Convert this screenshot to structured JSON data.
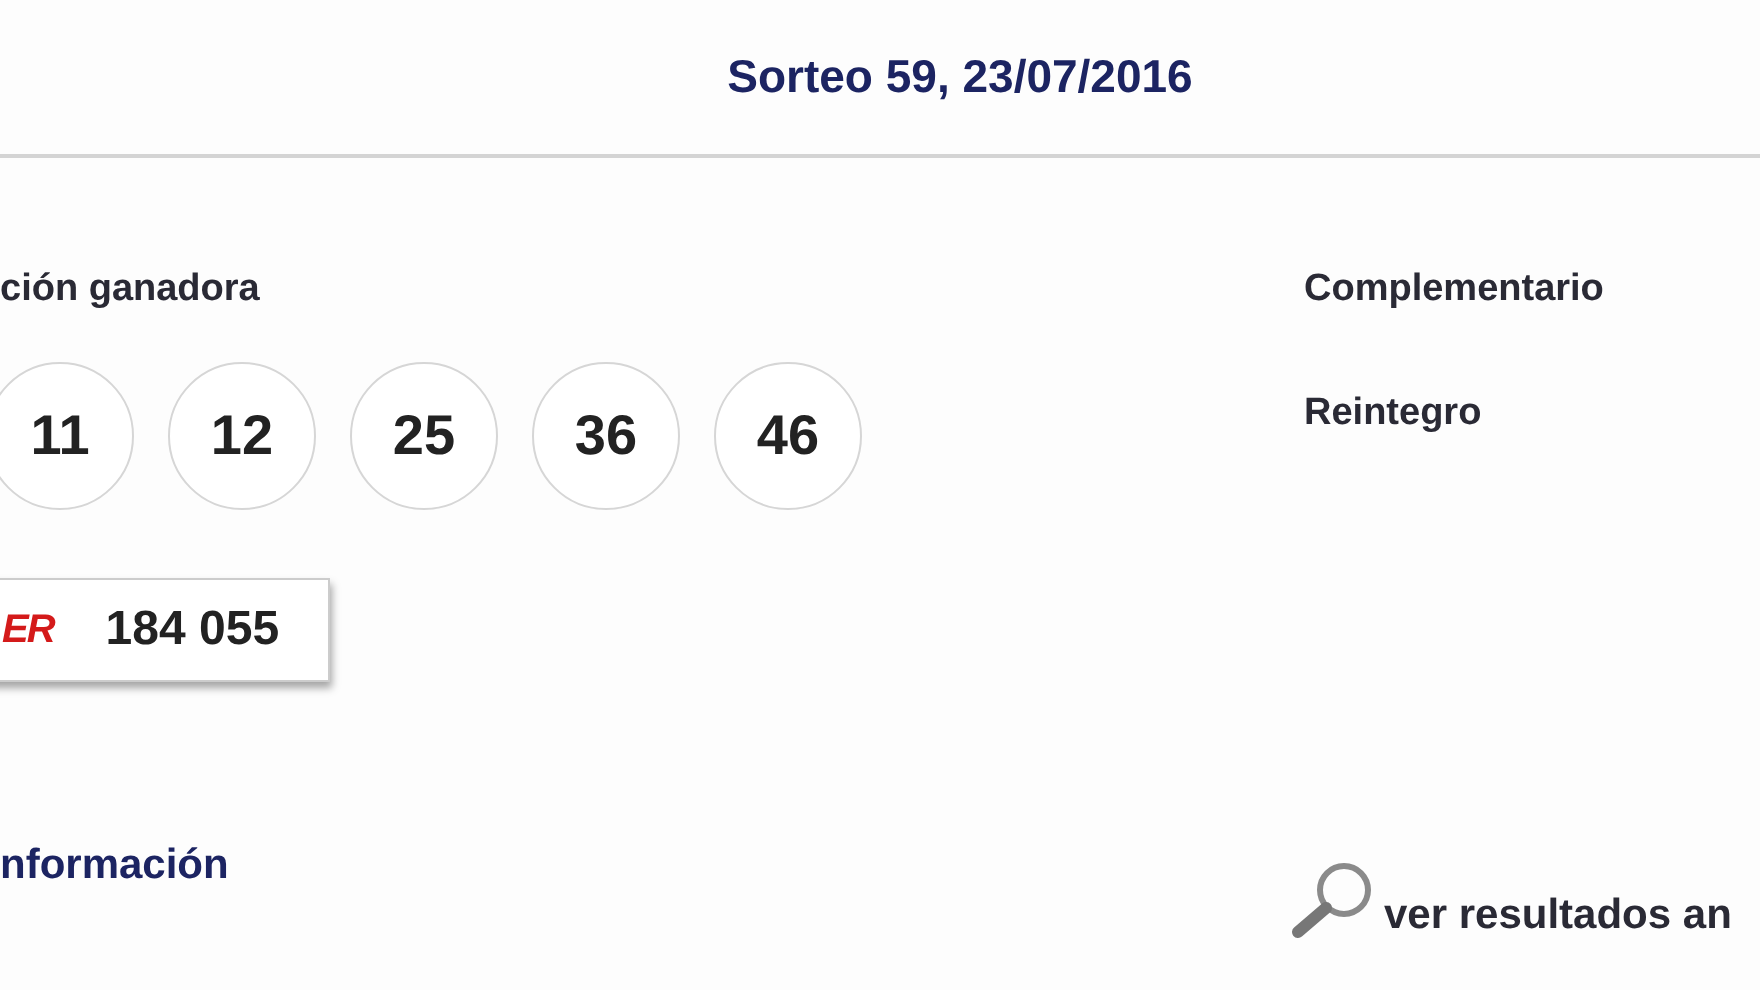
{
  "header": {
    "title": "Sorteo 59, 23/07/2016"
  },
  "winning": {
    "label": "ción ganadora",
    "numbers": [
      "11",
      "12",
      "25",
      "36",
      "46"
    ]
  },
  "joker": {
    "label": "ER",
    "number": "184 055"
  },
  "side": {
    "complementario": "Complementario",
    "reintegro": "Reintegro"
  },
  "info": {
    "label": "nformación"
  },
  "results_link": "ver resultados an"
}
